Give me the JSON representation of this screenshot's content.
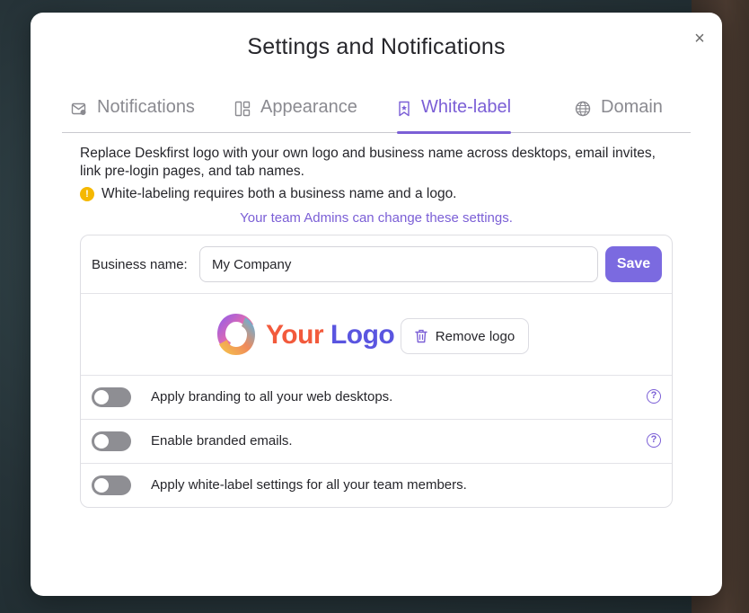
{
  "dialog": {
    "title": "Settings and Notifications",
    "close_symbol": "×"
  },
  "tabs": [
    {
      "label": "Notifications",
      "icon": "mail-bell-icon",
      "active": false
    },
    {
      "label": "Appearance",
      "icon": "layout-icon",
      "active": false
    },
    {
      "label": "White-label",
      "icon": "bookmark-star-icon",
      "active": true
    },
    {
      "label": "Domain",
      "icon": "globe-icon",
      "active": false
    }
  ],
  "white_label": {
    "description": "Replace Deskfirst logo with your own logo and business name across desktops, email invites, link pre-login pages, and tab names.",
    "warning_icon": "!",
    "warning": "White-labeling requires both a business name and a logo.",
    "admin_note": "Your team Admins can change these settings.",
    "business_name_label": "Business name:",
    "business_name_value": "My Company",
    "save_label": "Save",
    "logo": {
      "text_your": "Your",
      "text_logo": "Logo"
    },
    "remove_logo_label": "Remove logo",
    "toggles": [
      {
        "label": "Apply branding to all your web desktops.",
        "enabled": false,
        "help": "?"
      },
      {
        "label": "Enable branded emails.",
        "enabled": false,
        "help": "?"
      },
      {
        "label": "Apply white-label settings for all your team members.",
        "enabled": false
      }
    ]
  },
  "colors": {
    "accent": "#7b5fd6",
    "save_button": "#7b6ae0",
    "warning": "#f5b800",
    "logo_your": "#f25a3c",
    "logo_logo": "#5a55e0",
    "toggle_off": "#8e8e93"
  }
}
